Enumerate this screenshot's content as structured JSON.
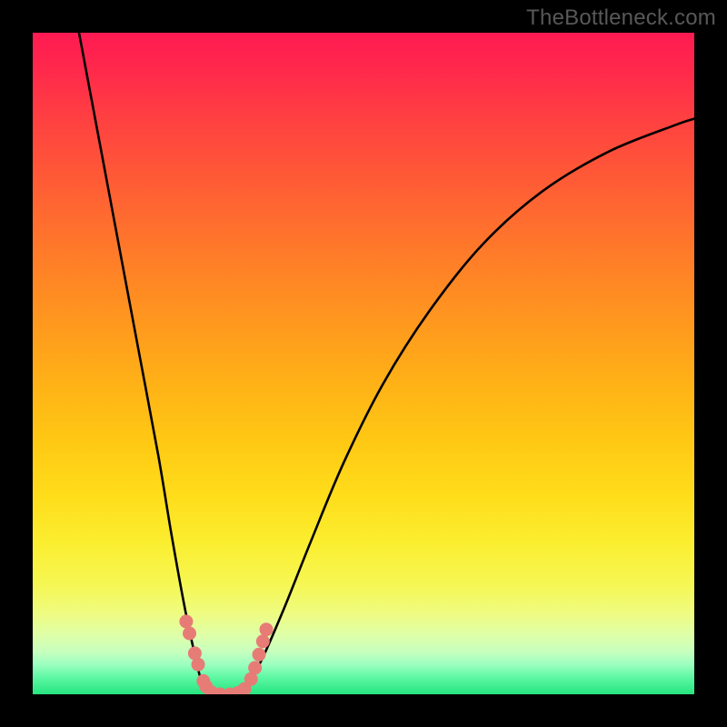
{
  "watermark": "TheBottleneck.com",
  "chart_data": {
    "type": "line",
    "title": "",
    "xlabel": "",
    "ylabel": "",
    "xlim": [
      0,
      1
    ],
    "ylim": [
      0,
      1
    ],
    "note": "Axes are unlabeled; values are normalized 0–1 where y=1 is the top of the colored region and y=0 is the bottom green band.",
    "series": [
      {
        "name": "bottleneck-curve",
        "x": [
          0.07,
          0.1,
          0.13,
          0.16,
          0.19,
          0.21,
          0.23,
          0.245,
          0.255,
          0.265,
          0.28,
          0.3,
          0.32,
          0.345,
          0.38,
          0.42,
          0.47,
          0.53,
          0.6,
          0.68,
          0.77,
          0.87,
          0.97,
          1.0
        ],
        "y": [
          1.0,
          0.84,
          0.68,
          0.52,
          0.36,
          0.24,
          0.13,
          0.06,
          0.02,
          0.005,
          0.0,
          0.0,
          0.01,
          0.05,
          0.13,
          0.23,
          0.35,
          0.47,
          0.58,
          0.68,
          0.76,
          0.82,
          0.86,
          0.87
        ]
      }
    ],
    "markers": {
      "name": "highlight-dots",
      "color": "#e77c77",
      "points_xy": [
        [
          0.232,
          0.11
        ],
        [
          0.237,
          0.092
        ],
        [
          0.245,
          0.062
        ],
        [
          0.25,
          0.045
        ],
        [
          0.258,
          0.02
        ],
        [
          0.262,
          0.012
        ],
        [
          0.27,
          0.003
        ],
        [
          0.283,
          0.0
        ],
        [
          0.298,
          0.0
        ],
        [
          0.31,
          0.002
        ],
        [
          0.32,
          0.008
        ],
        [
          0.33,
          0.023
        ],
        [
          0.336,
          0.04
        ],
        [
          0.342,
          0.06
        ],
        [
          0.348,
          0.08
        ],
        [
          0.353,
          0.098
        ]
      ]
    },
    "background_gradient": {
      "direction": "top-to-bottom",
      "stops": [
        {
          "pos": 0.0,
          "color": "#ff1a52"
        },
        {
          "pos": 0.3,
          "color": "#ff712d"
        },
        {
          "pos": 0.62,
          "color": "#ffc914"
        },
        {
          "pos": 0.83,
          "color": "#f6f754"
        },
        {
          "pos": 0.95,
          "color": "#9bffc0"
        },
        {
          "pos": 1.0,
          "color": "#26e47f"
        }
      ]
    }
  }
}
